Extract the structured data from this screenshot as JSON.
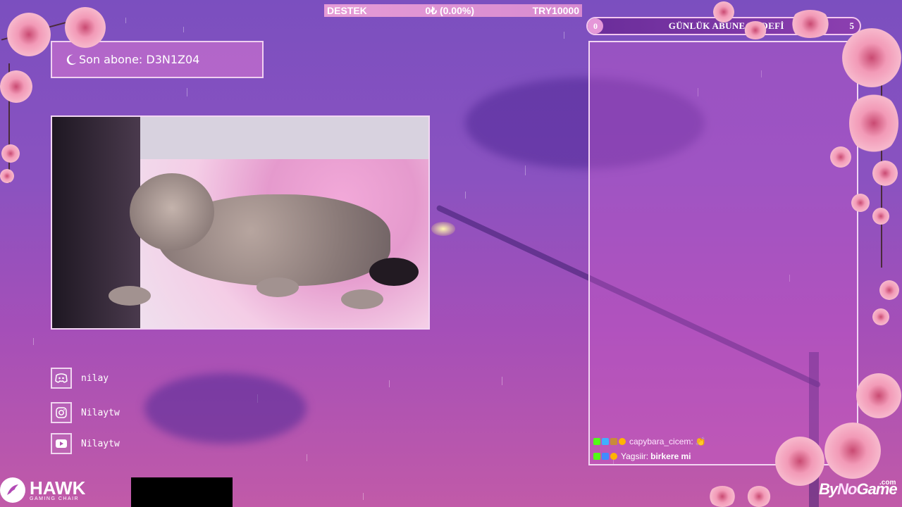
{
  "donation_bar": {
    "label": "DESTEK",
    "amount_text": "0₺ (0.00%)",
    "goal_text": "TRY10000"
  },
  "sub_goal": {
    "current": "0",
    "title": "GÜNLÜK ABUNE HEDEFİ",
    "target": "5"
  },
  "last_sub": {
    "text": "Son abone: D3N1Z04"
  },
  "socials": [
    {
      "icon": "discord-icon",
      "label": "nilay"
    },
    {
      "icon": "instagram-icon",
      "label": "Nilaytw"
    },
    {
      "icon": "youtube-icon",
      "label": "Nilaytw"
    }
  ],
  "chat": {
    "messages": [
      {
        "user": "capybara_cicem",
        "separator": " :",
        "message": "👏"
      },
      {
        "user": "Yagsiir",
        "separator": " :",
        "message": "birkere mi"
      }
    ]
  },
  "sponsors": {
    "hawk_name": "HAWK",
    "hawk_sub": "GAMING CHAIR",
    "bynogame_by": "By",
    "bynogame_no": "No",
    "bynogame_game": "Game",
    "bynogame_com": ".com"
  },
  "colors": {
    "accent_pink": "#e597d8",
    "frame_border": "#f3d6f3",
    "kick_green": "#53fc18"
  }
}
